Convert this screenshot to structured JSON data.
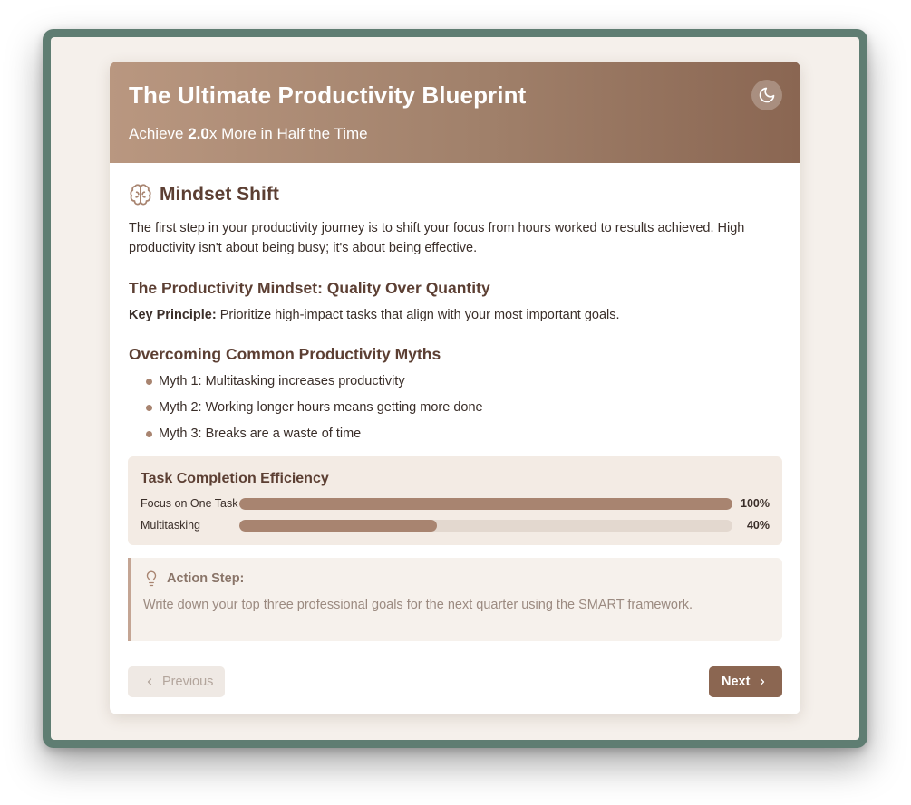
{
  "header": {
    "title": "The Ultimate Productivity Blueprint",
    "subtitle_prefix": "Achieve ",
    "subtitle_multiplier": "2.0",
    "subtitle_suffix": "x More in Half the Time",
    "theme_toggle_icon": "moon-icon"
  },
  "section": {
    "icon": "brain-icon",
    "title": "Mindset Shift",
    "intro": "The first step in your productivity journey is to shift your focus from hours worked to results achieved. High productivity isn't about being busy; it's about being effective.",
    "subheading_1": "The Productivity Mindset: Quality Over Quantity",
    "principle_label": "Key Principle:",
    "principle_text": " Prioritize high-impact tasks that align with your most important goals.",
    "subheading_2": "Overcoming Common Productivity Myths",
    "myths": [
      "Myth 1: Multitasking increases productivity",
      "Myth 2: Working longer hours means getting more done",
      "Myth 3: Breaks are a waste of time"
    ]
  },
  "chart_data": {
    "type": "bar",
    "title": "Task Completion Efficiency",
    "categories": [
      "Focus on One Task",
      "Multitasking"
    ],
    "values": [
      100,
      40
    ],
    "value_labels": [
      "100%",
      "40%"
    ],
    "ylim": [
      0,
      100
    ]
  },
  "action": {
    "icon": "lightbulb-icon",
    "label": "Action Step:",
    "text": "Write down your top three professional goals for the next quarter using the SMART framework."
  },
  "nav": {
    "previous_label": "Previous",
    "next_label": "Next"
  },
  "colors": {
    "accent": "#8b6651",
    "bar_fill": "#a88470",
    "bar_track": "#e3d8cf",
    "frame": "#5f7d72"
  }
}
